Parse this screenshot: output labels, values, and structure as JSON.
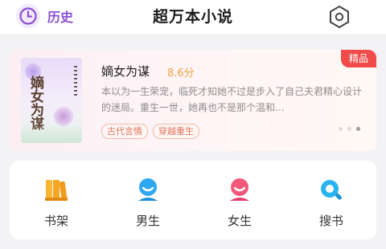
{
  "header": {
    "history_label": "历史",
    "title": "超万本小说"
  },
  "book": {
    "badge": "精品",
    "name": "嫡女为谋",
    "score": "8.6分",
    "description": "本以为一生荣宠，临死才知她不过是步入了自己夫君精心设计的迷局。重生一世，她再也不是那个温和…",
    "tags": [
      "古代言情",
      "穿越重生"
    ],
    "cover_title": "嫡女为谋",
    "carousel": {
      "total": 3,
      "active": 3
    }
  },
  "categories": [
    {
      "label": "书架",
      "icon": "bookshelf-icon",
      "color": "#f5a623"
    },
    {
      "label": "男生",
      "icon": "male-user-icon",
      "color": "#2fa8f2"
    },
    {
      "label": "女生",
      "icon": "female-user-icon",
      "color": "#f2587a"
    },
    {
      "label": "搜书",
      "icon": "search-book-icon",
      "color": "#29b4f0"
    }
  ],
  "colors": {
    "accent_purple": "#8a4fd6",
    "badge_red": "#f04b4b",
    "score_orange": "#f0a042"
  }
}
